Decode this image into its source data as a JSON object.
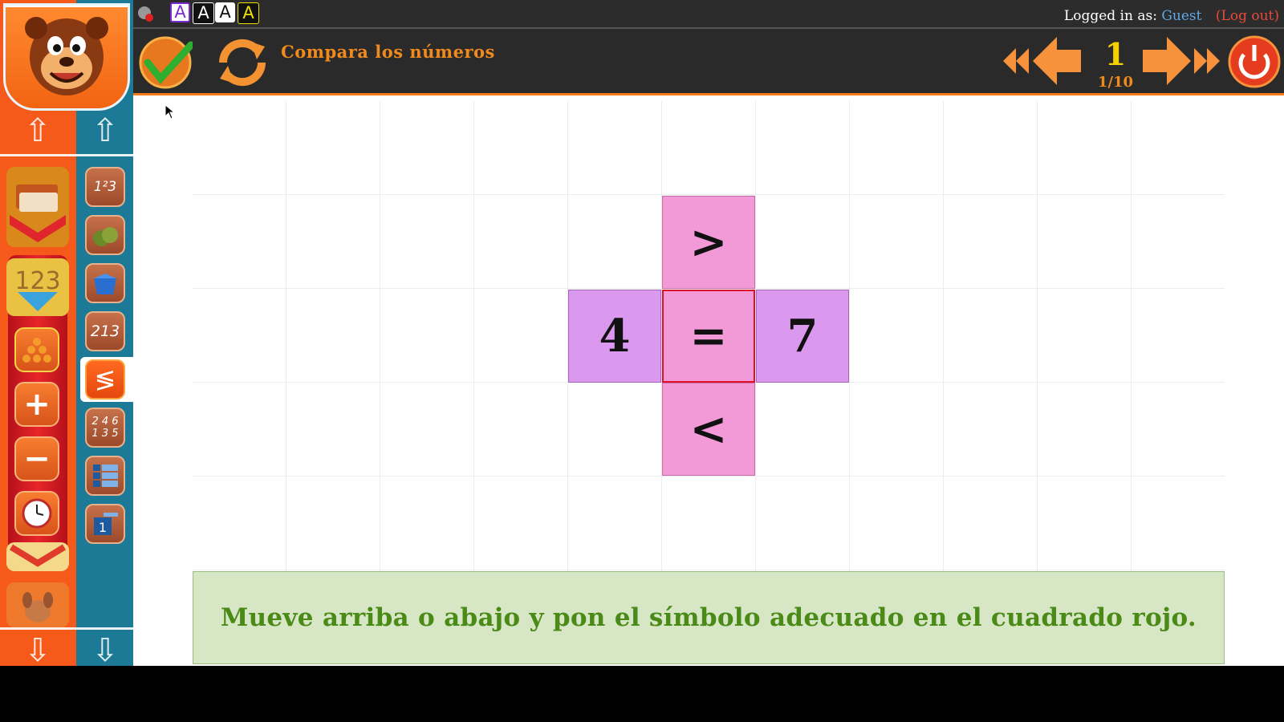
{
  "header": {
    "accessibility_buttons": [
      "A",
      "A",
      "A",
      "A"
    ],
    "logged_in_label": "Logged in as:",
    "user": "Guest",
    "logout": "(Log out)"
  },
  "toolbar": {
    "title": "Compara los números",
    "page_number": "1",
    "page_of": "1/10"
  },
  "sidebar_teal": {
    "items": [
      "1 2 3",
      "apples",
      "box",
      "2 1 3",
      "≶",
      "2 4 6 / 1 3 5",
      "table",
      "1"
    ]
  },
  "puzzle": {
    "top_symbol": ">",
    "left_number": "4",
    "center_symbol": "=",
    "right_number": "7",
    "bottom_symbol": "<"
  },
  "instruction": "Mueve arriba o abajo y pon el símbolo adecuado en el cuadrado rojo.",
  "colors": {
    "orange": "#f55a1b",
    "teal": "#1d7a96",
    "symbol_tile": "#f29ad8",
    "number_tile": "#da99ee",
    "instruction_bg": "#d7e6c5",
    "instruction_text": "#4a8a16"
  }
}
